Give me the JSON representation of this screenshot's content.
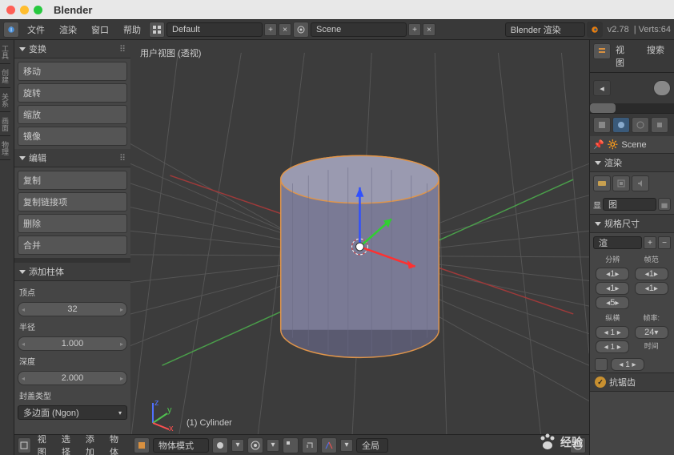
{
  "title": "Blender",
  "header": {
    "menu": [
      "文件",
      "渲染",
      "窗口",
      "帮助"
    ],
    "layout_dd": "Default",
    "scene_dd": "Scene",
    "engine_dd": "Blender 渲染",
    "version": "v2.78",
    "verts": "Verts:64"
  },
  "left_tabs": [
    "工具",
    "创建",
    "关系",
    "画面",
    "物理"
  ],
  "panels": {
    "transform": {
      "title": "变换",
      "items": [
        "移动",
        "旋转",
        "缩放",
        "镜像"
      ]
    },
    "edit": {
      "title": "编辑",
      "items": [
        "复制",
        "复制链接项",
        "删除",
        "合并"
      ]
    },
    "add_cylinder": {
      "title": "添加柱体",
      "vertex_label": "顶点",
      "vertex_val": "32",
      "radius_label": "半径",
      "radius_val": "1.000",
      "depth_label": "深度",
      "depth_val": "2.000",
      "cap_label": "封盖类型",
      "cap_val": "多边面 (Ngon)"
    }
  },
  "viewport": {
    "label": "用户视图 (透视)",
    "object": "(1) Cylinder",
    "footer": {
      "view": "视图",
      "select": "选择",
      "add": "添加",
      "object": "物体",
      "mode": "物体模式",
      "global": "全局"
    }
  },
  "right": {
    "view_btn": "视图",
    "search_btn": "搜索",
    "scene": "Scene",
    "render_header": "渲染",
    "display_label": "显",
    "dims_header": "规格尺寸",
    "render_mode": "渲",
    "res_label": "分辨",
    "aspect_label": "帧范",
    "res_x": "1",
    "res_y": "1",
    "res_pct": "5",
    "frame_start": "1",
    "frame_end": "1",
    "vert_label": "纵横",
    "fps_label": "帧率:",
    "fps_val": "24",
    "time_label": "时间"
  },
  "bottom": {
    "antialias": "抗锯齿"
  },
  "watermark": "经验"
}
